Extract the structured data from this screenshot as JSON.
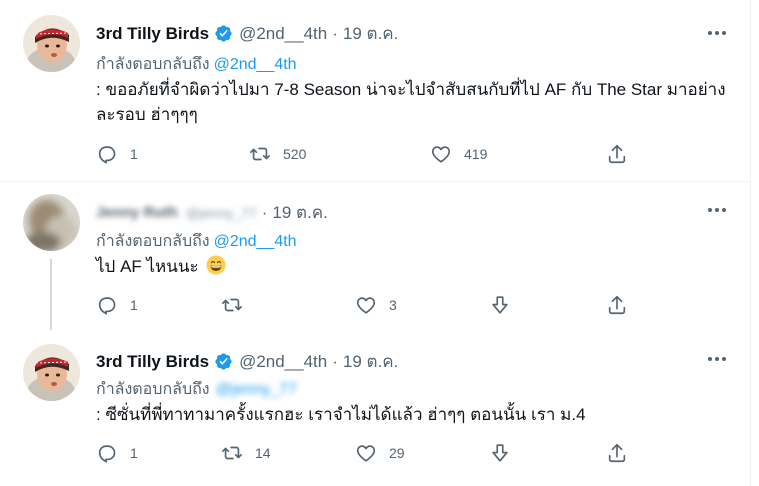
{
  "tweets": [
    {
      "name": "3rd Tilly Birds",
      "handle": "@2nd__4th",
      "date": "19 ต.ค.",
      "replying_label": "กำลังตอบกลับถึง",
      "replying_to": "@2nd__4th",
      "text": ": ขออภัยที่จำผิดว่าไปมา 7-8 Season น่าจะไปจำสับสนกับที่ไป AF กับ The Star มาอย่างละรอบ ฮ่าๆๆๆ",
      "replies": "1",
      "retweets": "520",
      "likes": "419"
    },
    {
      "name": "Jenny Ruth",
      "handle": "@jenny_77",
      "date": "19 ต.ค.",
      "replying_label": "กำลังตอบกลับถึง",
      "replying_to": "@2nd__4th",
      "text": "ไป AF ไหนนะ",
      "replies": "1",
      "retweets": "",
      "likes": "3"
    },
    {
      "name": "3rd Tilly Birds",
      "handle": "@2nd__4th",
      "date": "19 ต.ค.",
      "replying_label": "กำลังตอบกลับถึง",
      "replying_to": "@jenny_77",
      "text": ": ซีซั่นที่พี่ทาทามาครั้งแรกฮะ เราจำไม่ได้แล้ว ฮ่าๆๆ ตอนนั้น เรา ม.4",
      "replies": "1",
      "retweets": "14",
      "likes": "29"
    }
  ],
  "separator": "·",
  "icons": {
    "verified": "verified-badge-icon",
    "more": "more-options-icon",
    "reply": "reply-icon",
    "retweet": "retweet-icon",
    "like": "heart-icon",
    "downvote": "downvote-icon",
    "share": "share-icon",
    "emoji": "grinning-face-emoji"
  },
  "colors": {
    "accent": "#1d9bf0",
    "secondary_text": "#536471",
    "primary_text": "#0f1419",
    "divider": "#eff3f4"
  }
}
